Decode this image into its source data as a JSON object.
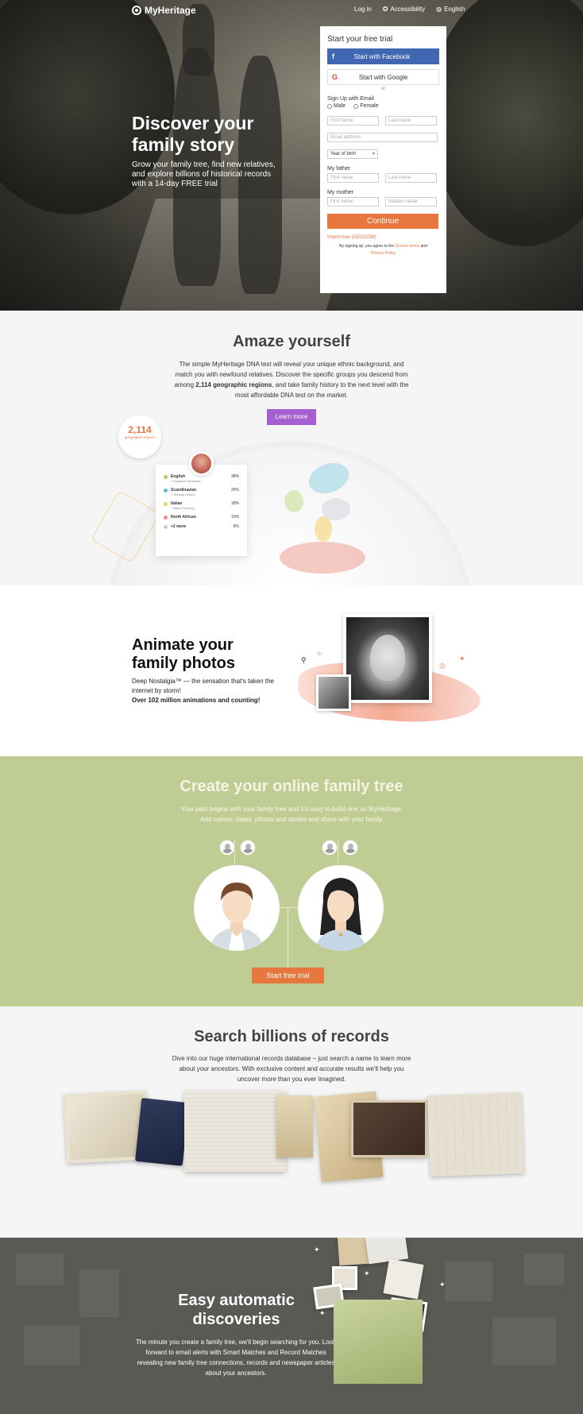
{
  "header": {
    "logo": "MyHeritage",
    "nav": [
      "Log in",
      "Accessibility",
      "English"
    ]
  },
  "hero": {
    "title": "Discover your family story",
    "subtitle": "Grow your family tree, find new relatives, and explore billions of historical records with a 14-day FREE trial"
  },
  "signup": {
    "title": "Start your free trial",
    "facebook": "Start with Facebook",
    "google": "Start with Google",
    "or": "or",
    "email_label": "Sign Up with Email",
    "gender_male": "Male",
    "gender_female": "Female",
    "first_name": "First name",
    "last_name": "Last name",
    "email": "Email address",
    "year_of_birth": "Year of birth",
    "father_label": "My father",
    "father_first": "First name",
    "father_last": "Last name",
    "mother_label": "My mother",
    "mother_first": "First name",
    "mother_maiden": "Maiden name",
    "continue": "Continue",
    "import": "Import tree (GEDCOM)",
    "terms_pre": "By signing up, you agree to the",
    "terms_link": "Service terms",
    "terms_and": "and",
    "privacy_link": "Privacy Policy"
  },
  "dna": {
    "title": "Amaze yourself",
    "text_1": "The simple MyHeritage DNA test will reveal your unique ethnic background, and match you with newfound relatives. Discover the specific groups you descend from among",
    "text_bold": "2,114 geographic regions",
    "text_2": ", and take family history to the next level with the most affordable DNA test on the market.",
    "button": "Learn more",
    "badge_number": "2,114",
    "badge_text": "geographic regions",
    "ethnicities": [
      {
        "name": "English",
        "sub": "+ England Ethnicities",
        "pct": "38%",
        "color": "#a9d06f"
      },
      {
        "name": "Scandinavian",
        "sub": "+ Norway (Viken)",
        "pct": "20%",
        "color": "#5cb8d6"
      },
      {
        "name": "Italian",
        "sub": "+ Italy (Tuscany)",
        "pct": "18%",
        "color": "#f0cf5c"
      },
      {
        "name": "North African",
        "sub": "",
        "pct": "10%",
        "color": "#ef8c86"
      },
      {
        "name": "+2 more",
        "sub": "",
        "pct": "8%",
        "color": "#cccccc"
      }
    ]
  },
  "animate": {
    "title": "Animate your family photos",
    "text": "Deep Nostalgia™ — the sensation that's taken the internet by storm!",
    "bold": "Over 102 million animations and counting!"
  },
  "tree": {
    "title": "Create your online family tree",
    "text": "Your past begins with your family tree and it's easy to build one on MyHeritage. Add names, dates, photos and stories and share with your family.",
    "button": "Start free trial"
  },
  "records": {
    "title": "Search billions of records",
    "text": "Dive into our huge international records database – just search a name to learn more about your ancestors. With exclusive content and accurate results we'll help you uncover more than you ever imagined."
  },
  "discoveries": {
    "title": "Easy automatic discoveries",
    "text": "The minute you create a family tree, we'll begin searching for you. Look forward to email alerts with Smart Matches and Record Matches revealing new family tree connections, records and newspaper articles about your ancestors."
  }
}
